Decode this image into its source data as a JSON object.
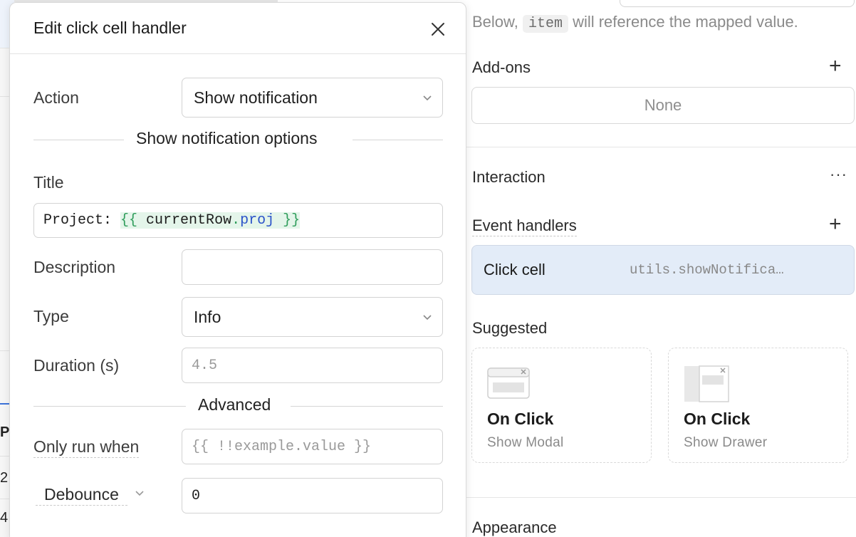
{
  "background": {
    "row_text_1": "P",
    "row_text_2": "2",
    "row_text_3": "4"
  },
  "modal": {
    "title": "Edit click cell handler",
    "action": {
      "label": "Action",
      "value": "Show notification"
    },
    "notification_section": "Show notification options",
    "title_field": {
      "label": "Title",
      "prefix": "Project: ",
      "expr_open": "{{ ",
      "expr_ident": "currentRow",
      "expr_dot": ".",
      "expr_prop": "proj",
      "expr_close": " }}"
    },
    "description": {
      "label": "Description",
      "value": ""
    },
    "type": {
      "label": "Type",
      "value": "Info"
    },
    "duration": {
      "label": "Duration (s)",
      "placeholder": "4.5"
    },
    "advanced_section": "Advanced",
    "only_run_when": {
      "label": "Only run when",
      "placeholder": "{{ !!example.value }}"
    },
    "debounce": {
      "label": "Debounce",
      "value": "0"
    }
  },
  "inspector": {
    "hint_prefix": "Below, ",
    "hint_code": "item",
    "hint_suffix": " will reference the mapped value.",
    "addons": {
      "title": "Add-ons",
      "value": "None"
    },
    "interaction": {
      "title": "Interaction",
      "more": "···"
    },
    "event_handlers": {
      "title": "Event handlers",
      "items": [
        {
          "event": "Click cell",
          "action": "utils.showNotifica…"
        }
      ]
    },
    "suggested": {
      "title": "Suggested",
      "cards": [
        {
          "title": "On Click",
          "subtitle": "Show Modal"
        },
        {
          "title": "On Click",
          "subtitle": "Show Drawer"
        }
      ]
    },
    "appearance": {
      "title": "Appearance"
    }
  },
  "colors": {
    "accent_blue": "#3c73d9",
    "handler_bg": "#e3ecf8",
    "expr_green": "#2f9d5b",
    "expr_bg": "#e4f5ea"
  }
}
